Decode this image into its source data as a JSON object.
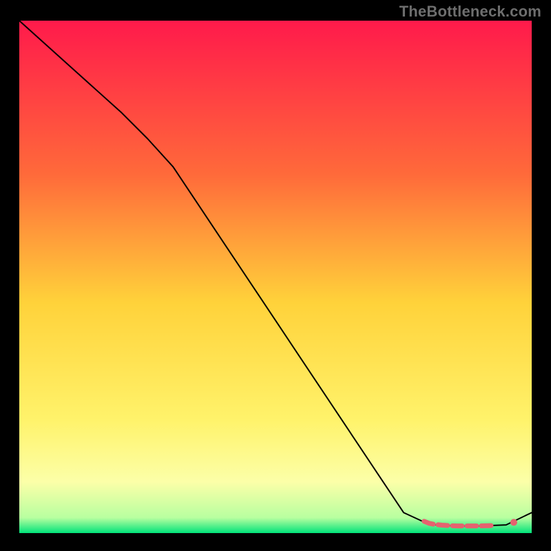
{
  "watermark": "TheBottleneck.com",
  "chart_data": {
    "type": "line",
    "title": "",
    "xlabel": "",
    "ylabel": "",
    "xlim": [
      0,
      100
    ],
    "ylim": [
      0,
      100
    ],
    "grid": false,
    "legend": false,
    "background_gradient": {
      "stops": [
        {
          "offset": 0.0,
          "color": "#ff1a4b"
        },
        {
          "offset": 0.3,
          "color": "#ff6a3a"
        },
        {
          "offset": 0.55,
          "color": "#ffd23a"
        },
        {
          "offset": 0.78,
          "color": "#fff36b"
        },
        {
          "offset": 0.9,
          "color": "#fcffa8"
        },
        {
          "offset": 0.97,
          "color": "#b8ffa0"
        },
        {
          "offset": 1.0,
          "color": "#00e37a"
        }
      ]
    },
    "series": [
      {
        "name": "bottleneck-curve",
        "color": "#000000",
        "width": 2,
        "x": [
          0,
          5,
          10,
          15,
          20,
          25,
          30,
          35,
          40,
          45,
          50,
          55,
          60,
          65,
          70,
          75,
          80,
          85,
          90,
          95,
          100
        ],
        "y": [
          100,
          95.5,
          91,
          86.5,
          82,
          77,
          71.5,
          64,
          56.5,
          49,
          41.5,
          34,
          26.5,
          19,
          11.5,
          4,
          1.7,
          1.4,
          1.4,
          1.6,
          4
        ]
      }
    ],
    "markers": [
      {
        "name": "optimal-band",
        "color": "#e5636f",
        "style": "thick-dashed-line",
        "x": [
          79,
          80,
          81,
          82.5,
          84,
          85.5,
          87,
          88.5,
          90,
          91.5,
          93
        ],
        "y": [
          2.3,
          1.9,
          1.7,
          1.55,
          1.45,
          1.4,
          1.4,
          1.4,
          1.4,
          1.45,
          1.5
        ]
      },
      {
        "name": "optimal-point",
        "color": "#e5636f",
        "style": "dot",
        "x": [
          96.5
        ],
        "y": [
          2.1
        ]
      }
    ]
  }
}
